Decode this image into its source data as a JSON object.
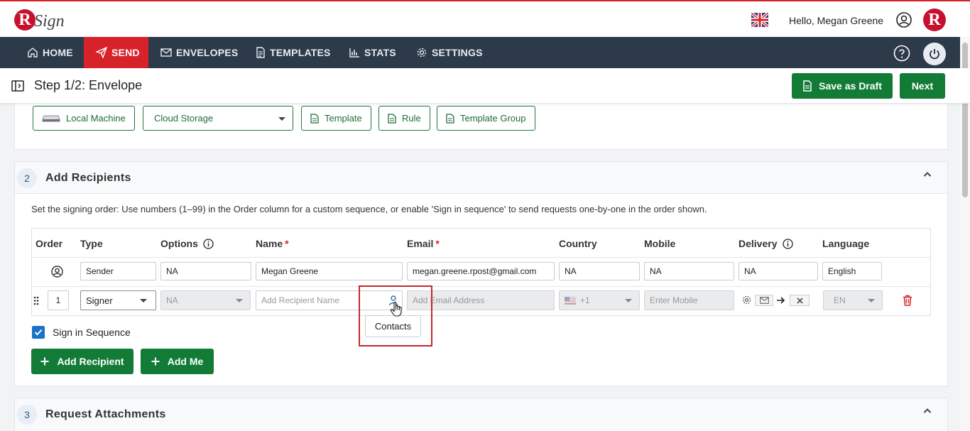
{
  "header": {
    "logo_letter": "R",
    "logo_text": "Sign",
    "greeting": "Hello, Megan Greene",
    "brand_letter": "R"
  },
  "nav": {
    "items": [
      {
        "label": "HOME",
        "icon": "home-icon"
      },
      {
        "label": "SEND",
        "icon": "send-icon",
        "active": true
      },
      {
        "label": "ENVELOPES",
        "icon": "envelope-icon"
      },
      {
        "label": "TEMPLATES",
        "icon": "document-icon"
      },
      {
        "label": "STATS",
        "icon": "chart-icon"
      },
      {
        "label": "SETTINGS",
        "icon": "gear-icon"
      }
    ]
  },
  "subbar": {
    "title": "Step 1/2: Envelope",
    "save_draft": "Save as Draft",
    "next": "Next"
  },
  "sources": {
    "local": "Local Machine",
    "cloud": "Cloud Storage",
    "template": "Template",
    "rule": "Rule",
    "template_group": "Template Group"
  },
  "recipients": {
    "number": "2",
    "title": "Add Recipients",
    "description": "Set the signing order: Use numbers (1–99) in the Order column for a custom sequence, or enable 'Sign in sequence' to send requests one-by-one in the order shown.",
    "columns": {
      "order": "Order",
      "type": "Type",
      "options": "Options",
      "name": "Name",
      "email": "Email",
      "country": "Country",
      "mobile": "Mobile",
      "delivery": "Delivery",
      "language": "Language",
      "required_mark": "*"
    },
    "sender_row": {
      "type": "Sender",
      "options": "NA",
      "name": "Megan Greene",
      "email": "megan.greene.rpost@gmail.com",
      "country": "NA",
      "mobile": "NA",
      "delivery": "NA",
      "language": "English"
    },
    "signer_row": {
      "order": "1",
      "type": "Signer",
      "options": "NA",
      "name_placeholder": "Add Recipient Name",
      "email_placeholder": "Add Email Address",
      "country_code": "+1",
      "mobile_placeholder": "Enter Mobile",
      "language": "EN"
    },
    "tooltip": "Contacts",
    "sign_in_sequence": "Sign in Sequence",
    "sign_in_sequence_checked": true,
    "add_recipient": "Add Recipient",
    "add_me": "Add Me"
  },
  "attachments": {
    "number": "3",
    "title": "Request Attachments"
  },
  "colors": {
    "brand_red": "#d8222a",
    "nav_bg": "#2d3a4a",
    "primary_green": "#127c37",
    "checkbox_blue": "#1a73c8"
  }
}
